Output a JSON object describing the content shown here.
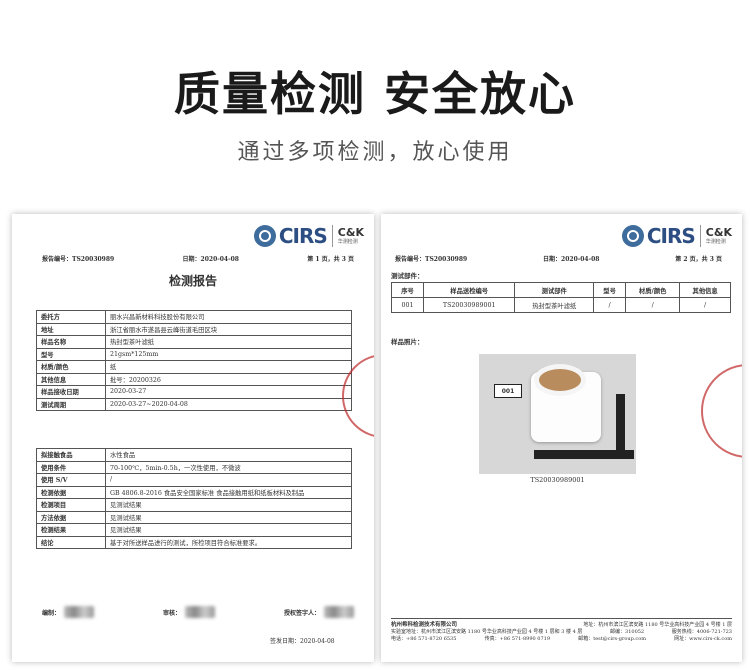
{
  "headline": "质量检测 安全放心",
  "subline": "通过多项检测，放心使用",
  "logo": {
    "brand": "CIRS",
    "partner": "C&K",
    "partner_cn": "华测检测"
  },
  "doc_left": {
    "report_no": "报告编号：TS20030989",
    "date": "日期：2020-04-08",
    "page": "第 1 页，共 3 页",
    "title": "检测报告",
    "info_rows": [
      {
        "k": "委托方",
        "v": "丽水兴昌新材料科技股份有限公司"
      },
      {
        "k": "地址",
        "v": "浙江省丽水市遂昌县云峰街道毛田区块"
      },
      {
        "k": "样品名称",
        "v": "热封型茶叶滤纸"
      },
      {
        "k": "型号",
        "v": "21gsm*125mm"
      },
      {
        "k": "材质/颜色",
        "v": "纸"
      },
      {
        "k": "其他信息",
        "v": "批号：20200326"
      },
      {
        "k": "样品接收日期",
        "v": "2020-03-27"
      },
      {
        "k": "测试周期",
        "v": "2020-03-27~2020-04-08"
      }
    ],
    "test_rows": [
      {
        "k": "拟接触食品",
        "v": "水性食品"
      },
      {
        "k": "使用条件",
        "v": "70-100℃，5min-0.5h，一次性使用，不微波"
      },
      {
        "k": "使用 S/V",
        "v": "/"
      },
      {
        "k": "检测依据",
        "v": "GB 4806.8-2016 食品安全国家标准 食品接触用纸和纸板材料及制品"
      },
      {
        "k": "检测项目",
        "v": "见测试结果"
      },
      {
        "k": "方法依据",
        "v": "见测试结果"
      },
      {
        "k": "检测结果",
        "v": "见测试结果"
      },
      {
        "k": "结论",
        "v": "基于对所送样品进行的测试，所检项目符合标准要求。"
      }
    ],
    "sig_labels": {
      "compiled": "编制：",
      "reviewed": "审核：",
      "approved": "授权签字人："
    },
    "sign_date": "签发日期：2020-04-08"
  },
  "doc_right": {
    "report_no": "报告编号：TS20030989",
    "date": "日期：2020-04-08",
    "page": "第 2 页，共 3 页",
    "section_parts": "测试部件：",
    "columns": [
      "序号",
      "样品送检编号",
      "测试部件",
      "型号",
      "材质/颜色",
      "其他信息"
    ],
    "rows": [
      [
        "001",
        "TS20030989001",
        "热封型茶叶滤纸",
        "/",
        "/",
        "/"
      ]
    ],
    "section_photo": "样品照片：",
    "photo_tag": "001",
    "caption": "TS20030989001",
    "footer": {
      "company": "杭州希科检测技术有限公司",
      "address": "地址：杭州市滨江区滨安路 1180 号华业高科技产业园 4 号楼 1 层",
      "lab": "实验室地址：杭州市滨江区滨安路 1180 号华业高科技产业园 4 号楼 1 层和 3 楼 4 层",
      "tel": "电话：+86 571-8720 6535",
      "fax": "传真：+86 571-8990 0719",
      "email": "邮箱：test@cirs-group.com",
      "web": "网址：www.cirs-ck.com",
      "postcode": "邮编：310052",
      "hotline": "服务热线：4006-721-723"
    }
  }
}
